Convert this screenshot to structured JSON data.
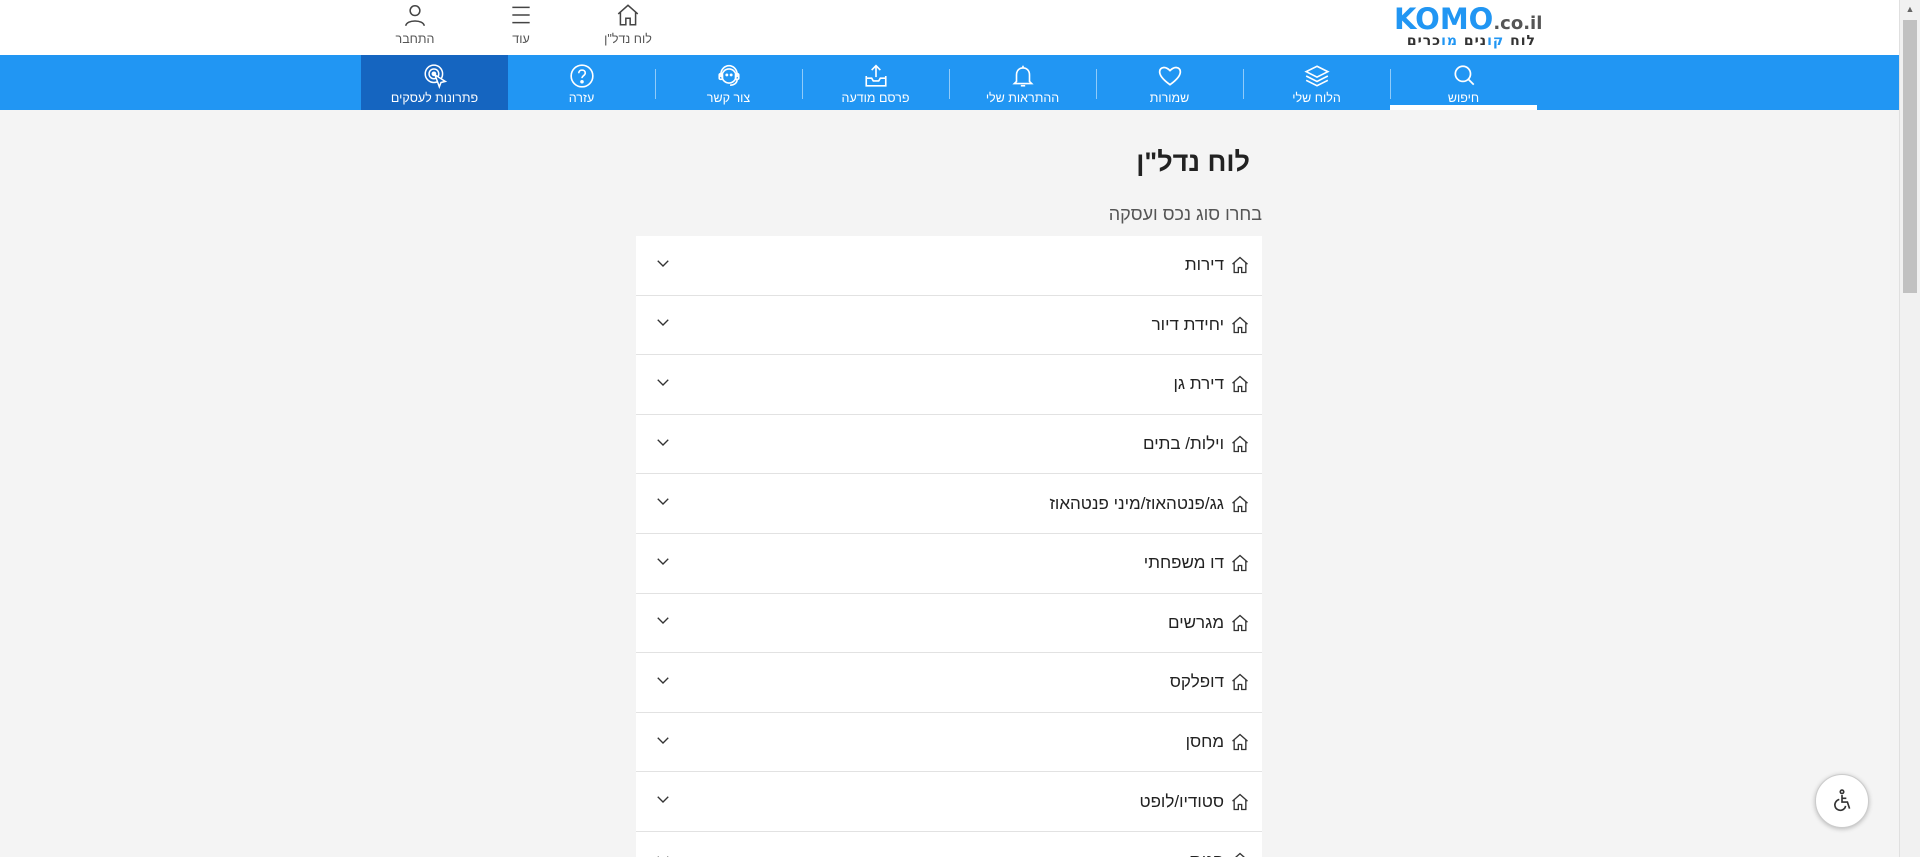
{
  "header": {
    "logo": {
      "brand": "KOMO",
      "tld": ".co.il",
      "slogan_part1": "לוח ",
      "slogan_accent1": "קו",
      "slogan_part2": "נים ",
      "slogan_accent2": "מו",
      "slogan_part3": "כרים"
    },
    "links": [
      {
        "label": "לוח נדל\"ן",
        "icon": "home-icon"
      },
      {
        "label": "עוד",
        "icon": "menu-icon"
      },
      {
        "label": "התחבר",
        "icon": "user-icon"
      }
    ]
  },
  "nav": {
    "items": [
      {
        "label": "חיפוש",
        "icon": "search-icon",
        "active": true
      },
      {
        "label": "הלוח שלי",
        "icon": "layers-icon"
      },
      {
        "label": "שמורות",
        "icon": "heart-icon"
      },
      {
        "label": "ההתראות שלי",
        "icon": "bell-icon"
      },
      {
        "label": "פרסם מודעה",
        "icon": "upload-tray-icon"
      },
      {
        "label": "צור קשר",
        "icon": "support-icon"
      },
      {
        "label": "עזרה",
        "icon": "help-icon"
      },
      {
        "label": "פתרונות לעסקים",
        "icon": "target-click-icon",
        "highlight": true
      }
    ],
    "accent_color": "#2196f3",
    "business_color": "#1565c0"
  },
  "main": {
    "title": "לוח נדל\"ן",
    "subtitle": "בחרו סוג נכס ועסקה",
    "categories": [
      "דירות",
      "יחידת דיור",
      "דירת גן",
      "וילות/ בתים",
      "גג/פנטהאוז/מיני פנטהאוז",
      "דו משפחתי",
      "מגרשים",
      "דופלקס",
      "מחסן",
      "סטודיו/לופט",
      "חנות"
    ]
  },
  "accessibility": {
    "icon": "wheelchair-icon"
  }
}
